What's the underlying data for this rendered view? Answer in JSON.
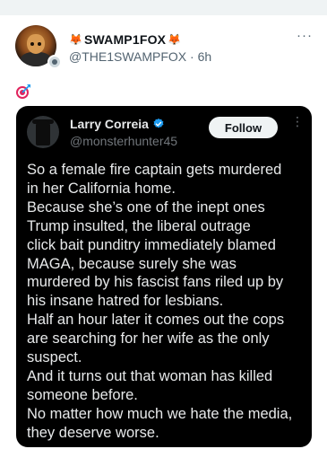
{
  "post": {
    "display_name": "SWAMP1FOX",
    "name_prefix_emoji": "🦊",
    "name_suffix_emoji": "🦊",
    "handle": "@THE1SWAMPFOX",
    "separator": "·",
    "time": "6h",
    "more": "···",
    "content_emoji": "🎯"
  },
  "quote": {
    "display_name": "Larry Correia",
    "handle": "@monsterhunter45",
    "follow_label": "Follow",
    "more": "⋮",
    "lines": [
      "So a female fire captain gets murdered",
      "in her California home.",
      "Because she’s one of the inept ones",
      "Trump insulted, the liberal outrage",
      "click bait punditry immediately blamed",
      "MAGA, because surely she was",
      "murdered by his fascist fans riled up by",
      "his insane hatred for lesbians.",
      "Half an hour later it comes out the cops",
      "are searching for her wife as the only",
      "suspect.",
      "And it turns out that woman has killed",
      "someone before.",
      "No matter how much we hate the media,",
      "they deserve worse."
    ]
  },
  "colors": {
    "verified": "#1d9bf0",
    "card_bg": "#000000",
    "handle_gray": "#536471"
  }
}
